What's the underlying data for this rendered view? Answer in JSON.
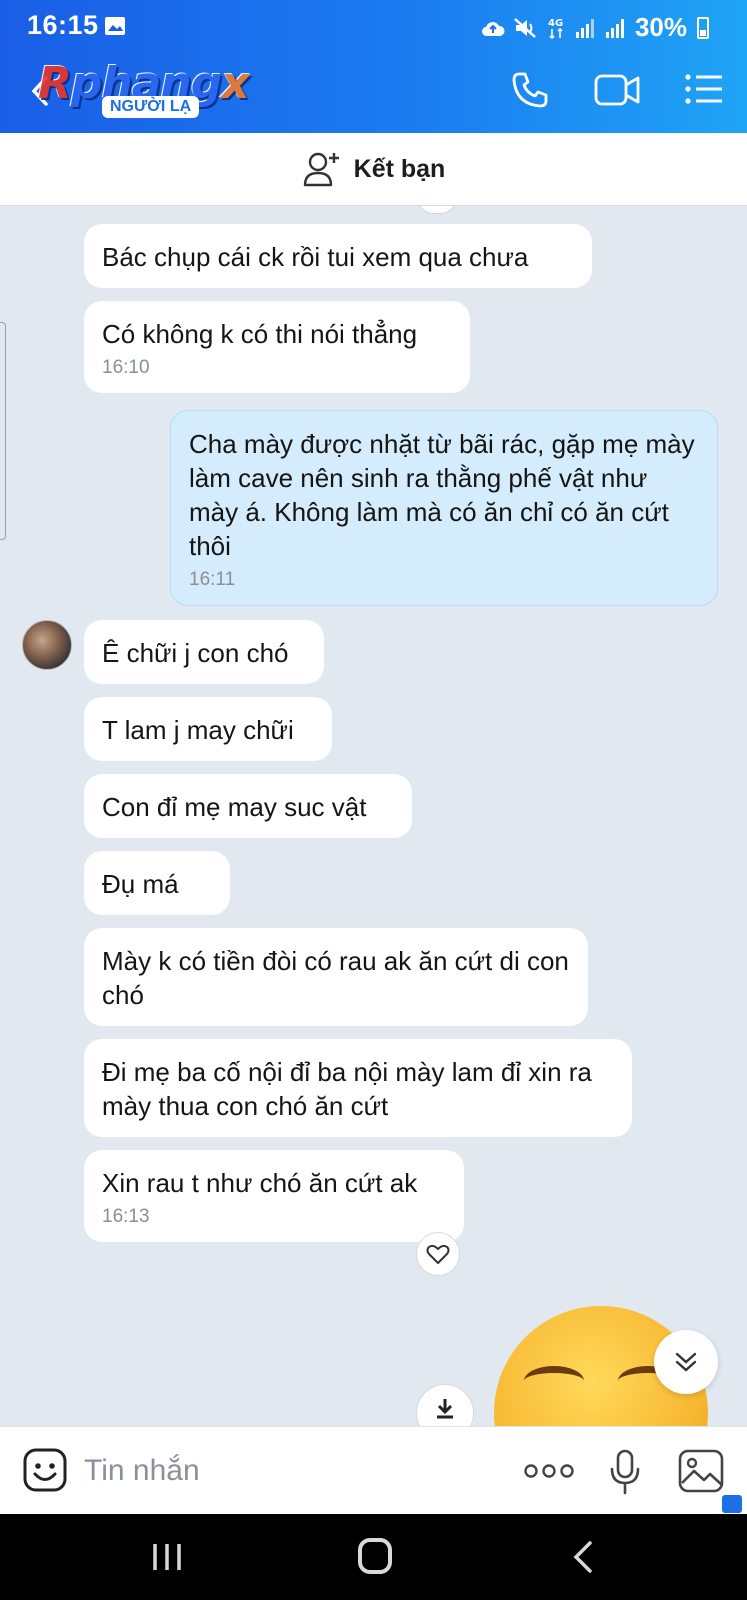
{
  "status_bar": {
    "time": "16:15",
    "network": "4G",
    "battery": "30%"
  },
  "header": {
    "logo_text_start": "R",
    "logo_text_mid": "phang",
    "logo_text_end": "x",
    "stranger_label": "NGƯỜI LẠ",
    "icons": [
      "back-icon",
      "call-icon",
      "video-icon",
      "menu-icon"
    ]
  },
  "add_friend": {
    "label": "Kết bạn"
  },
  "messages": [
    {
      "side": "received",
      "text": "Bác chụp cái ck rồi tui xem qua chưa",
      "time": ""
    },
    {
      "side": "received",
      "text": "Có không k có thi nói thẳng",
      "time": "16:10"
    },
    {
      "side": "sent",
      "text": "Cha mày được nhặt từ bãi rác, gặp mẹ mày làm cave nên sinh ra thằng phế vật như mày á. Không làm mà có ăn chỉ có ăn cứt thôi",
      "time": "16:11"
    },
    {
      "side": "received",
      "text": "Ê chữi j con chó",
      "time": ""
    },
    {
      "side": "received",
      "text": "T lam j may chữi",
      "time": ""
    },
    {
      "side": "received",
      "text": "Con đỉ mẹ may suc vật",
      "time": ""
    },
    {
      "side": "received",
      "text": "Đụ má",
      "time": ""
    },
    {
      "side": "received",
      "text": "Mày k có tiền đòi có rau ak ăn cứt di con chó",
      "time": ""
    },
    {
      "side": "received",
      "text": "Đi mẹ ba cố nội đỉ ba nội mày lam đỉ xin ra mày thua con chó ăn cứt",
      "time": ""
    },
    {
      "side": "received",
      "text": "Xin rau t như chó ăn cứt ak",
      "time": "16:13"
    }
  ],
  "composer": {
    "placeholder": "Tin nhắn"
  },
  "colors": {
    "header_gradient_start": "#1a5ee6",
    "header_gradient_end": "#1fa4f5",
    "chat_background": "#e2e8f0",
    "sent_bubble": "#d5ecfc",
    "received_bubble": "#ffffff"
  }
}
